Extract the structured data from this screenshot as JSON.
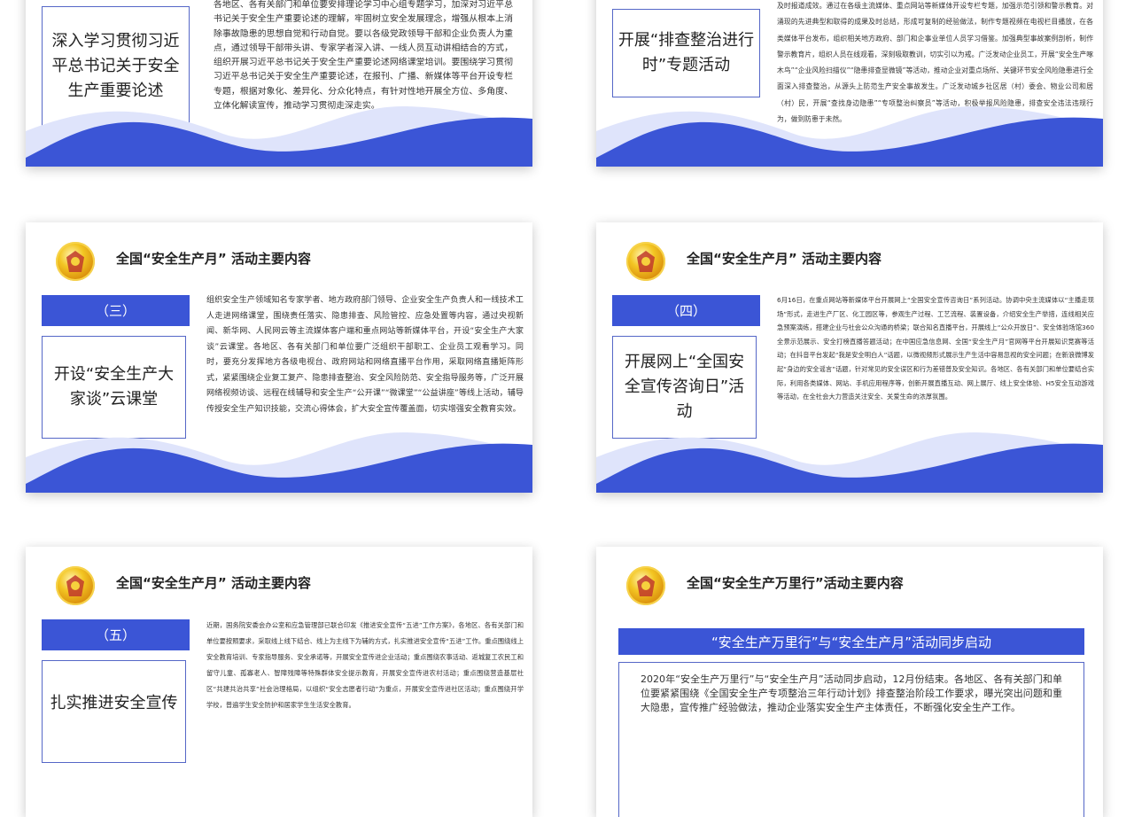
{
  "slides": {
    "s1": {
      "topic": "深入学习贯彻习近平总书记关于安全生产重要论述",
      "body": "各地区、各有关部门和单位要安排理论学习中心组专题学习，加深对习近平总书记关于安全生产重要论述的理解，牢固树立安全发展理念，增强从根本上消除事故隐患的思想自觉和行动自觉。要以各级党政领导干部和企业负责人为重点，通过领导干部带头讲、专家学者深入讲、一线人员互动讲相结合的方式，组织开展习近平总书记关于安全生产重要论述网络课堂培训。要围绕学习贯彻习近平总书记关于安全生产重要论述，在报刊、广播、新媒体等平台开设专栏专题，根据对象化、差异化、分众化特点，有针对性地开展全方位、多角度、立体化解读宣传，推动学习贯彻走深走实。"
    },
    "s2": {
      "topic": "开展“排查整治进行时”专题活动",
      "body": "及时报道成效。通过在各级主流媒体、重点网站等新媒体开设专栏专题，加强示范引领和警示教育。对涌现的先进典型和取得的成果及时总结，形成可复制的经验做法，制作专题视频在电视栏目播放，在各类媒体平台发布，组织相关地方政府、部门和企事业单位人员学习借鉴。加强典型事故案例剖析，制作警示教育片，组织人员在线观看，深刻吸取教训，切实引以为戒。广泛发动企业员工，开展“安全生产啄木鸟”“企业风险扫描仪”“隐患排查显微镜”等活动，推动企业对重点场所、关键环节安全风险隐患进行全面深入排查整治，从源头上防范生产安全事故发生。广泛发动城乡社区居（村）委会、物业公司和居（村）民，开展“查找身边隐患”“专项整治纠察员”等活动，积极举报风险隐患，排查安全违法违规行为，做到防患于未然。"
    },
    "s3": {
      "title": "全国“安全生产月”  活动主要内容",
      "num": "（三）",
      "topic": "开设“安全生产大家谈”云课堂",
      "body": "组织安全生产领域知名专家学者、地方政府部门领导、企业安全生产负责人和一线技术工人走进网络课堂，围绕责任落实、隐患排查、风险管控、应急处置等内容，通过央视新闻、新华网、人民网云等主流媒体客户端和重点网站等新媒体平台，开设“安全生产大家谈”云课堂。各地区、各有关部门和单位要广泛组织干部职工、企业员工观看学习。同时，要充分发挥地方各级电视台、政府网站和网络直播平台作用，采取网络直播矩阵形式，紧紧围绕企业复工复产、隐患排查整治、安全风险防范、安全指导服务等，广泛开展网络视频访谈、远程在线辅导和安全生产“公开课”“微课堂”“公益讲座”等线上活动，辅导传授安全生产知识技能，交流心得体会，扩大安全宣传覆盖面，切实增强安全教育实效。"
    },
    "s4": {
      "title": "全国“安全生产月”  活动主要内容",
      "num": "（四）",
      "topic": "开展网上“全国安全宣传咨询日”活动",
      "body": "6月16日，在重点网站等新媒体平台开展网上“全国安全宣传咨询日”系列活动。协调中央主流媒体以“主播走现场”形式，走进生产厂区、化工园区等，参观生产过程、工艺流程、装置设备，介绍安全生产举措，连线相关应急预案演练，搭建企业与社会公众沟通的桥梁；联合知名直播平台，开展线上“公众开放日”、安全体验场馆360全景示范展示、安全打榜直播答题活动；在中国应急信息网、全国“安全生产月”官网等平台开展知识竞赛等活动；在抖音平台发起“我是安全明白人”话题，以微视频形式展示生产生活中容易忽视的安全问题；在新浪微博发起“身边的安全谣言”话题，针对常见的安全误区和行为差错普及安全知识。各地区、各有关部门和单位要结合实际，利用各类媒体、网站、手机应用程序等，创新开展直播互动、网上展厅、线上安全体验、H5安全互动游戏等活动，在全社会大力营造关注安全、关爱生命的浓厚氛围。"
    },
    "s5": {
      "title": "全国“安全生产月”  活动主要内容",
      "num": "（五）",
      "topic": "扎实推进安全宣传",
      "body": "近期，国务院安委会办公室和应急管理部已联合印发《推进安全宣传“五进”工作方案》，各地区、各有关部门和单位要按照要求，采取线上线下结合、线上为主线下为辅的方式，扎实推进安全宣传“五进”工作。重点围绕线上安全教育培训、专家指导服务、安全承诺等，开展安全宣传进企业活动；重点围绕农事活动、返城复工农民工和留守儿童、孤寡老人、智障残障等特殊群体安全提示教育，开展安全宣传进农村活动；重点围绕营造基层社区“共建共治共享”社会治理格局，以组织“安全志愿者行动”为重点，开展安全宣传进社区活动；重点围绕开学学校，普遍学生安全防护和居家学生生活安全教育。"
    },
    "s6": {
      "title": "全国“安全生产万里行”活动主要内容",
      "bar": "“安全生产万里行”与“安全生产月”活动同步启动",
      "body": "2020年“安全生产万里行”与“安全生产月”活动同步启动，12月份结束。各地区、各有关部门和单位要紧紧围绕《全国安全生产专项整治三年行动计划》排查整治阶段工作要求，曝光突出问题和重大隐患，宣传推广经验做法，推动企业落实安全生产主体责任，不断强化安全生产工作。"
    }
  },
  "colors": {
    "accent_blue": "#3b55d6",
    "light_wave": "#dfe4fb",
    "border_blue": "#5567c7"
  }
}
